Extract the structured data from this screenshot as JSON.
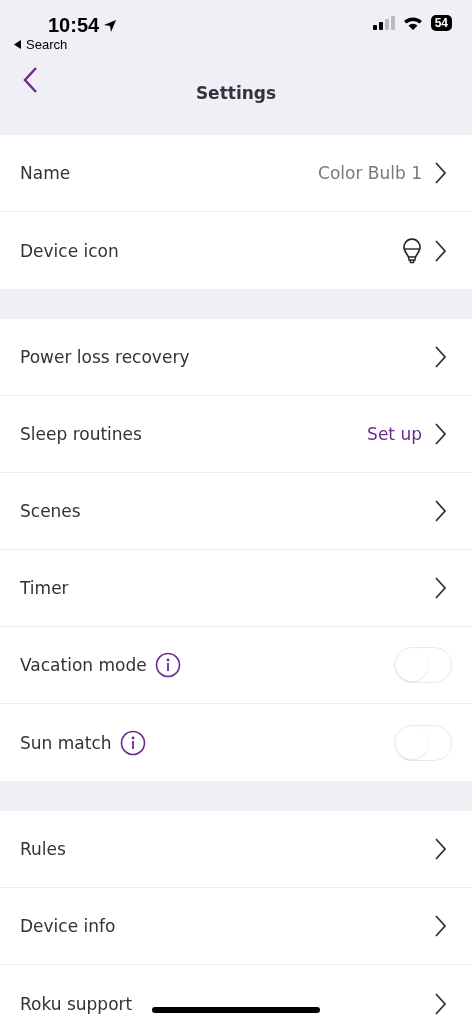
{
  "status_bar": {
    "time": "10:54",
    "back_label": "Search",
    "battery": "54"
  },
  "header": {
    "title": "Settings"
  },
  "sections": [
    {
      "rows": [
        {
          "kind": "link",
          "label": "Name",
          "value": "Color Bulb 1",
          "color": "#7a7a7a"
        },
        {
          "kind": "link",
          "label": "Device icon",
          "show_bulb": true
        }
      ]
    },
    {
      "rows": [
        {
          "kind": "link",
          "label": "Power loss recovery"
        },
        {
          "kind": "link",
          "label": "Sleep routines",
          "value": "Set up",
          "color": "#6a2c91"
        },
        {
          "kind": "link",
          "label": "Scenes"
        },
        {
          "kind": "link",
          "label": "Timer"
        },
        {
          "kind": "toggle",
          "label": "Vacation mode",
          "info": true,
          "on": false
        },
        {
          "kind": "toggle",
          "label": "Sun match",
          "info": true,
          "on": false
        }
      ]
    },
    {
      "rows": [
        {
          "kind": "link",
          "label": "Rules"
        },
        {
          "kind": "link",
          "label": "Device info"
        },
        {
          "kind": "link",
          "label": "Roku support"
        }
      ]
    }
  ]
}
